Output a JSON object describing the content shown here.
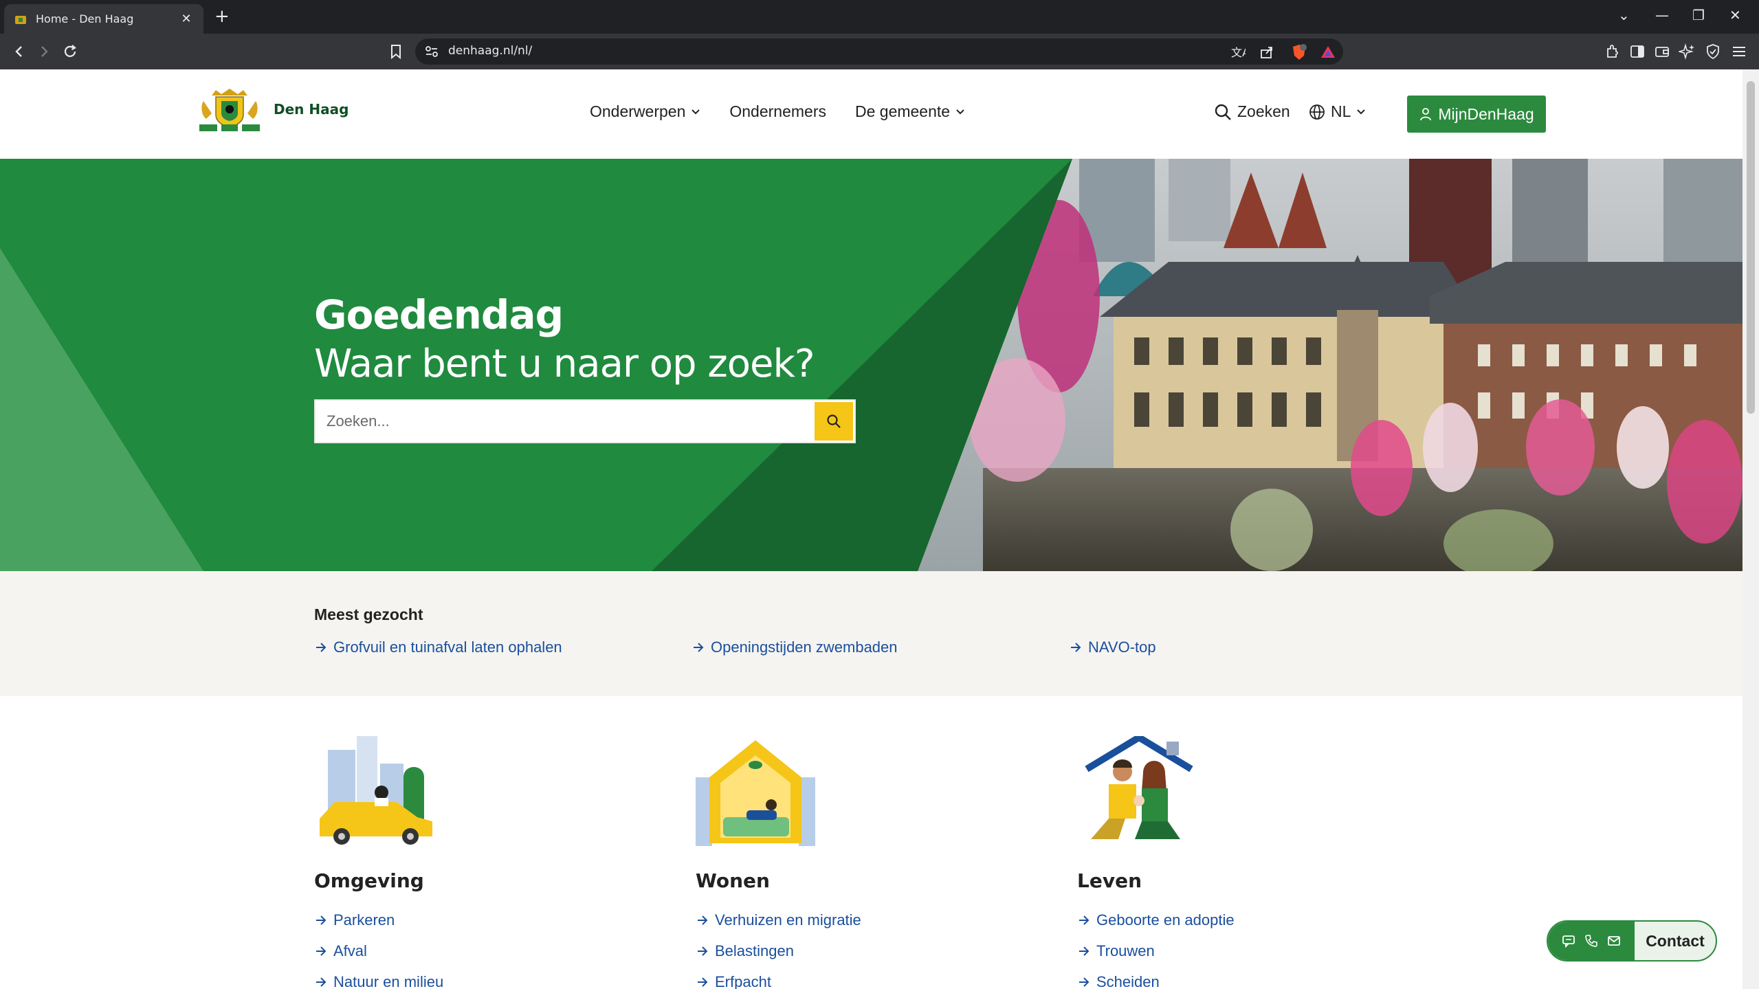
{
  "browser": {
    "tab_title": "Home - Den Haag",
    "url": "denhaag.nl/nl/"
  },
  "header": {
    "brand": "Den Haag",
    "nav": [
      {
        "label": "Onderwerpen",
        "has_dropdown": true
      },
      {
        "label": "Ondernemers",
        "has_dropdown": false
      },
      {
        "label": "De gemeente",
        "has_dropdown": true
      }
    ],
    "search_label": "Zoeken",
    "language": "NL",
    "account_button": "MijnDenHaag"
  },
  "hero": {
    "title": "Goedendag",
    "subtitle": "Waar bent u naar op zoek?",
    "search_placeholder": "Zoeken..."
  },
  "popular": {
    "heading": "Meest gezocht",
    "links": [
      "Grofvuil en tuinafval laten ophalen",
      "Openingstijden zwembaden",
      "NAVO-top"
    ]
  },
  "categories": [
    {
      "title": "Omgeving",
      "links": [
        "Parkeren",
        "Afval",
        "Natuur en milieu"
      ]
    },
    {
      "title": "Wonen",
      "links": [
        "Verhuizen en migratie",
        "Belastingen",
        "Erfpacht"
      ]
    },
    {
      "title": "Leven",
      "links": [
        "Geboorte en adoptie",
        "Trouwen",
        "Scheiden"
      ]
    }
  ],
  "contact": {
    "label": "Contact"
  },
  "colors": {
    "brand_green": "#2b8a3e",
    "dark_green": "#1f6d35",
    "search_yellow": "#f5c518",
    "link_blue": "#1a4f9c",
    "popular_bg": "#f5f4f1"
  }
}
